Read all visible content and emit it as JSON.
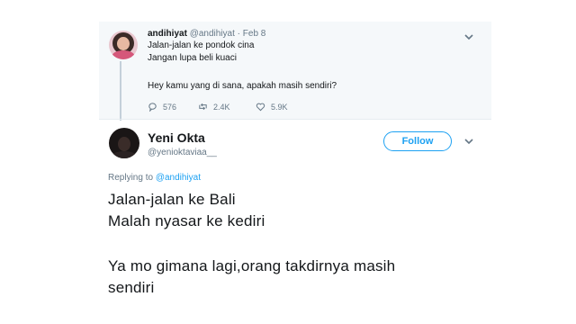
{
  "quoted_tweet": {
    "name": "andihiyat",
    "handle": "@andihiyat",
    "separator": "·",
    "date": "Feb 8",
    "lines": [
      "Jalan-jalan ke pondok cina",
      "Jangan lupa beli kuaci",
      "",
      "Hey kamu yang di sana, apakah masih sendiri?"
    ],
    "replies": "576",
    "retweets": "2.4K",
    "likes": "5.9K"
  },
  "main_tweet": {
    "name": "Yeni Okta",
    "handle": "@yenioktaviaa__",
    "follow_label": "Follow",
    "replying_prefix": "Replying to",
    "replying_handle": "@andihiyat",
    "lines": [
      "Jalan-jalan ke Bali",
      "Malah nyasar ke kediri",
      "",
      "Ya mo gimana lagi,orang takdirnya masih",
      "sendiri"
    ]
  },
  "colors": {
    "accent": "#1da1f2",
    "text": "#14171a",
    "secondary": "#657786",
    "quoted_background": "#f5f8fa"
  },
  "icons": {
    "reply": "reply-icon",
    "retweet": "retweet-icon",
    "like": "heart-icon",
    "menu": "chevron-down-icon"
  }
}
